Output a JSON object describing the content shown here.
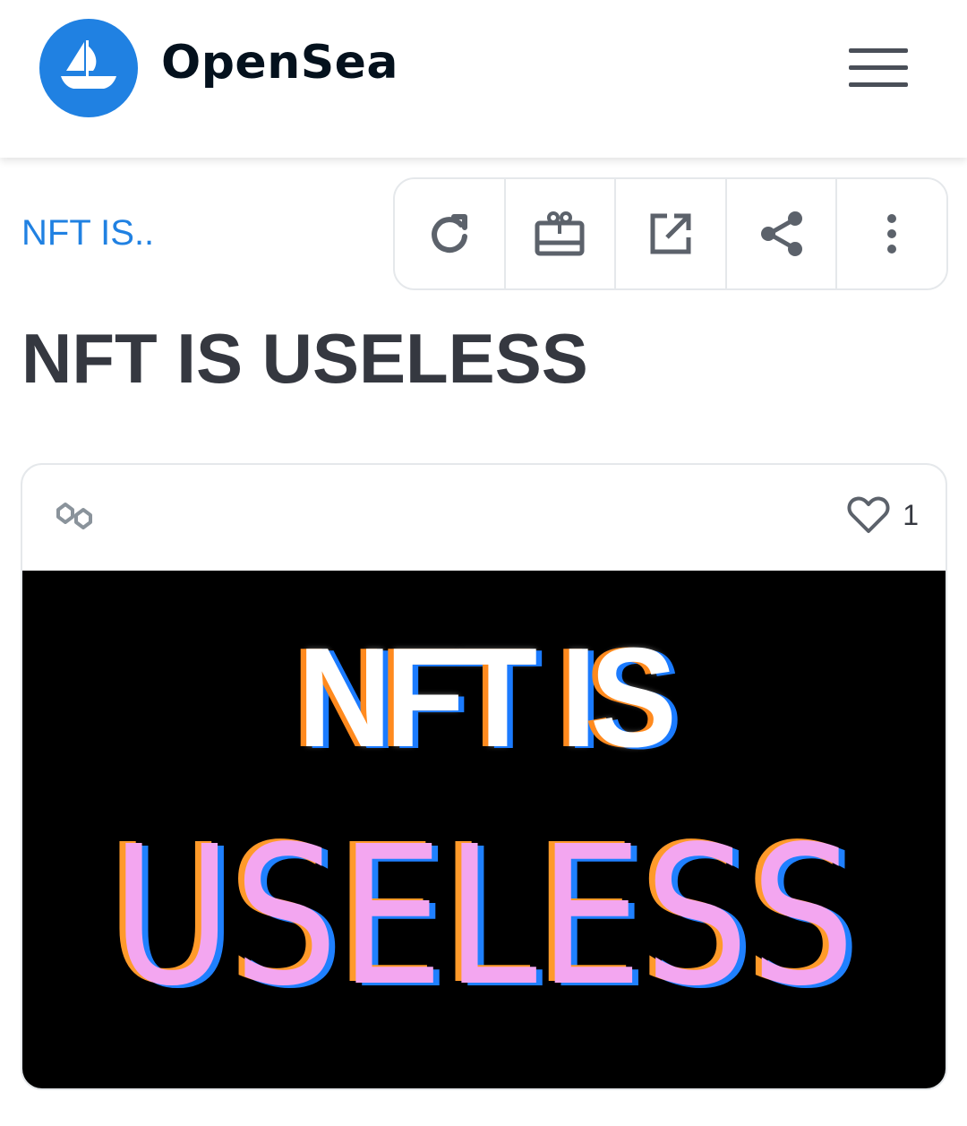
{
  "app": {
    "brand": "OpenSea",
    "colors": {
      "brand_blue": "#2081E2",
      "text_dark": "#04111D",
      "title_text": "#353840",
      "border": "#e5e8eb"
    }
  },
  "header": {
    "logo_icon": "opensea-ship-icon",
    "menu_icon": "hamburger-menu-icon"
  },
  "toolbar": {
    "collection_link": "NFT IS..",
    "actions": [
      {
        "name": "refresh",
        "icon": "refresh-icon"
      },
      {
        "name": "transfer",
        "icon": "gift-icon"
      },
      {
        "name": "open-external",
        "icon": "external-link-icon"
      },
      {
        "name": "share",
        "icon": "share-icon"
      },
      {
        "name": "more",
        "icon": "more-vertical-icon"
      }
    ]
  },
  "item": {
    "title": "NFT IS USELESS",
    "chain_icon": "polygon-chain-icon",
    "favorites_count": "1",
    "artwork": {
      "line1": "NFT IS",
      "line2": "USELESS"
    }
  }
}
